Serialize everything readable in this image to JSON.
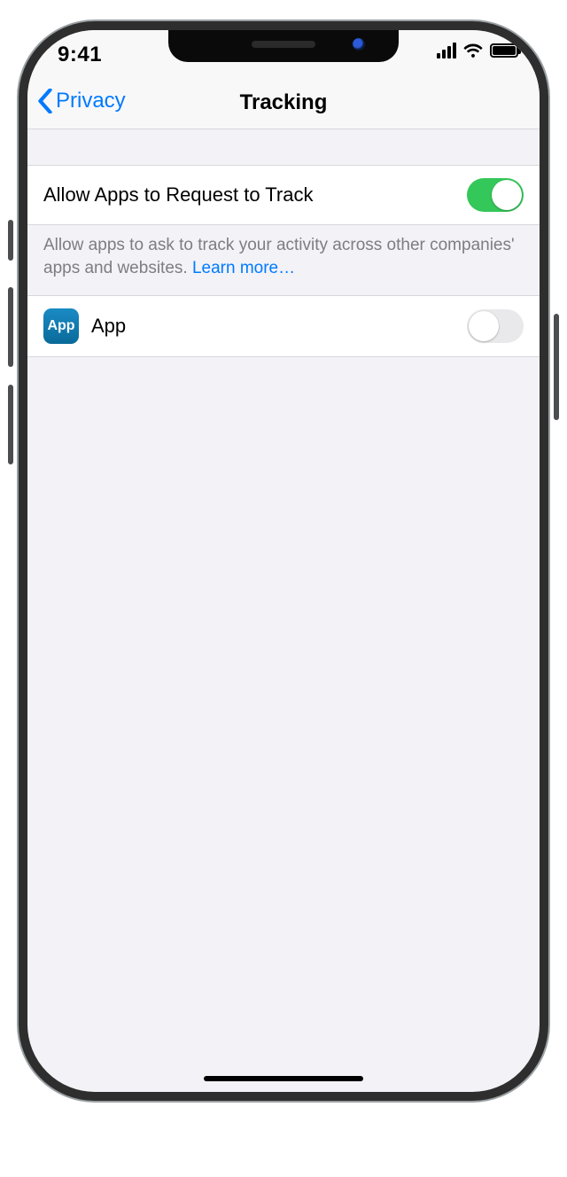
{
  "status": {
    "time": "9:41"
  },
  "nav": {
    "back_label": "Privacy",
    "title": "Tracking"
  },
  "settings": {
    "allow_tracking": {
      "label": "Allow Apps to Request to Track",
      "on": true
    },
    "footer": {
      "text": "Allow apps to ask to track your activity across other companies' apps and websites. ",
      "learn_more": "Learn more…"
    },
    "apps": [
      {
        "name": "App",
        "icon_label": "App",
        "on": false
      }
    ]
  },
  "colors": {
    "accent": "#007aff",
    "toggle_on": "#34c759"
  }
}
